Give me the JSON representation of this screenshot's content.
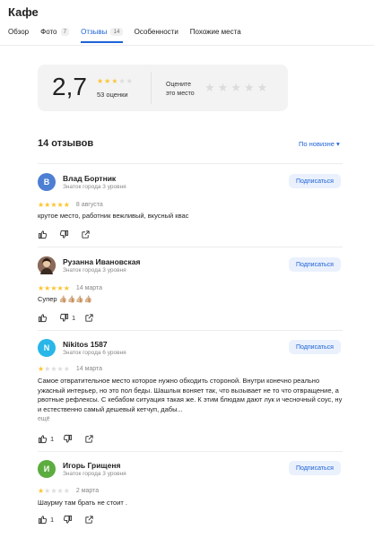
{
  "page": {
    "title": "Кафе"
  },
  "tabs": [
    {
      "label": "Обзор",
      "count": ""
    },
    {
      "label": "Фото",
      "count": "7"
    },
    {
      "label": "Отзывы",
      "count": "14",
      "active": true
    },
    {
      "label": "Особенности",
      "count": ""
    },
    {
      "label": "Похожие места",
      "count": ""
    }
  ],
  "rating": {
    "score": "2,7",
    "stars_filled": 2.7,
    "count_label": "53 оценки",
    "rate_prompt_line1": "Оцените",
    "rate_prompt_line2": "это место"
  },
  "reviews_section": {
    "title": "14 отзывов",
    "sort_label": "По новизне ▾"
  },
  "colors": {
    "accent": "#1d62d8",
    "star": "#fcc430",
    "star_empty": "#dcdcdc"
  },
  "reviews": [
    {
      "avatar_letter": "В",
      "avatar_color": "#4d7fd3",
      "author": "Влад Бортник",
      "level": "Знаток города 3 уровня",
      "subscribe": "Подписаться",
      "stars": 5,
      "date": "8 августа",
      "text": "крутое место, работник вежливый, вкусный квас",
      "more": "",
      "likes": "",
      "dislikes": ""
    },
    {
      "avatar_letter": "",
      "avatar_color": "#6b5347",
      "author": "Рузанна Ивановская",
      "level": "Знаток города 3 уровня",
      "subscribe": "Подписаться",
      "stars": 5,
      "date": "14 марта",
      "text": "Супер 👍🏼👍🏼👍🏼👍🏼",
      "more": "",
      "likes": "",
      "dislikes": "1"
    },
    {
      "avatar_letter": "N",
      "avatar_color": "#29b6e8",
      "author": "Nikitos 1587",
      "level": "Знаток города 6 уровня",
      "subscribe": "Подписаться",
      "stars": 1,
      "date": "14 марта",
      "text": "Самое отвратительное место которое нужно обходить стороной. Внутри конечно реально ужасный интерьер, но это пол беды. Шашлык воняет так, что вызывает не то что отвращение, а рвотные рефлексы. С кебабом ситуация такая же. К этим блюдам дают лук и чесночный соус, ну и естественно самый дешевый кетчуп, дабы...",
      "more": "ещё",
      "likes": "1",
      "dislikes": ""
    },
    {
      "avatar_letter": "И",
      "avatar_color": "#5cac3f",
      "author": "Игорь Грищеня",
      "level": "Знаток города 3 уровня",
      "subscribe": "Подписаться",
      "stars": 1,
      "date": "2 марта",
      "text": "Шаурму там брать не стоит .",
      "more": "",
      "likes": "1",
      "dislikes": ""
    }
  ]
}
